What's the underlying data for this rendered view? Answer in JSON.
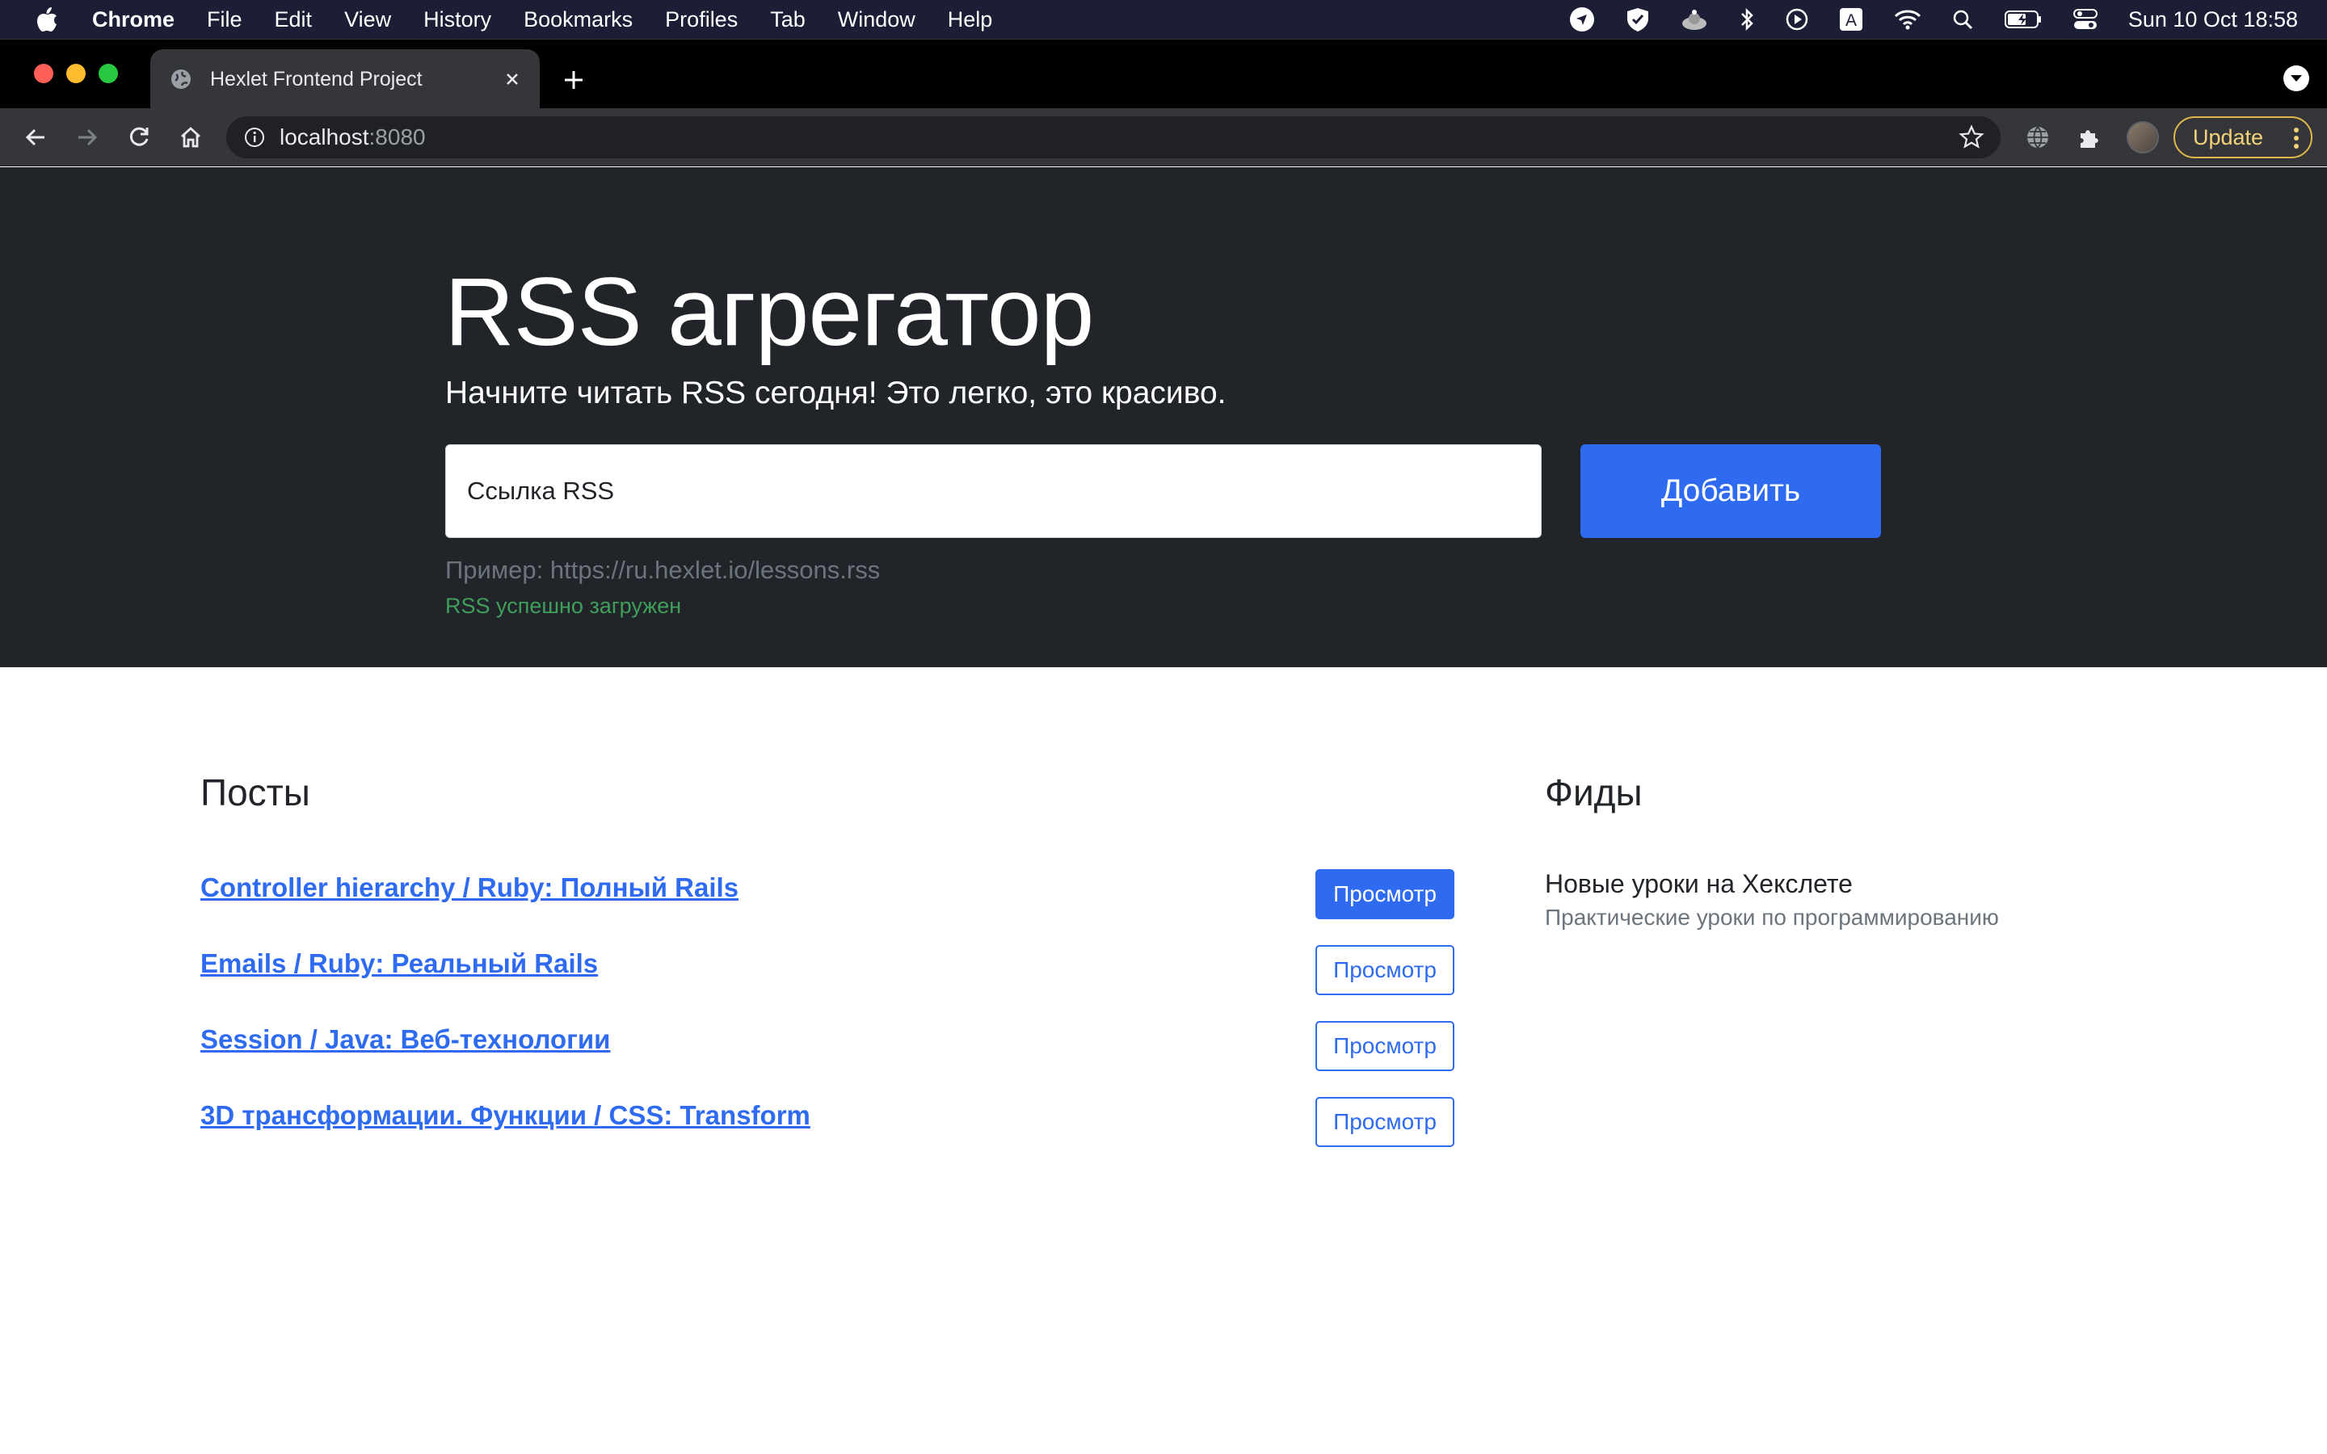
{
  "menubar": {
    "app": "Chrome",
    "items": [
      "File",
      "Edit",
      "View",
      "History",
      "Bookmarks",
      "Profiles",
      "Tab",
      "Window",
      "Help"
    ],
    "clock": "Sun 10 Oct  18:58",
    "keyboard_layout": "A"
  },
  "browser": {
    "tab_title": "Hexlet Frontend Project",
    "url_host": "localhost",
    "url_port": ":8080",
    "update_label": "Update"
  },
  "hero": {
    "title": "RSS агрегатор",
    "lead": "Начните читать RSS сегодня! Это легко, это красиво.",
    "input_placeholder": "Ссылка RSS",
    "add_label": "Добавить",
    "example": "Пример: https://ru.hexlet.io/lessons.rss",
    "feedback": "RSS успешно загружен"
  },
  "posts": {
    "heading": "Посты",
    "items": [
      {
        "title": "Controller hierarchy / Ruby: Полный Rails",
        "button": "Просмотр",
        "active": true
      },
      {
        "title": "Emails / Ruby: Реальный Rails",
        "button": "Просмотр",
        "active": false
      },
      {
        "title": "Session / Java: Веб-технологии",
        "button": "Просмотр",
        "active": false
      },
      {
        "title": "3D трансформации. Функции / CSS: Transform",
        "button": "Просмотр",
        "active": false
      }
    ]
  },
  "feeds": {
    "heading": "Фиды",
    "items": [
      {
        "title": "Новые уроки на Хекслете",
        "description": "Практические уроки по программированию"
      }
    ]
  },
  "colors": {
    "hero_bg": "#212529",
    "primary": "#2f6bf0",
    "success": "#3f9f5a",
    "menubar_bg": "#1b1e35"
  }
}
